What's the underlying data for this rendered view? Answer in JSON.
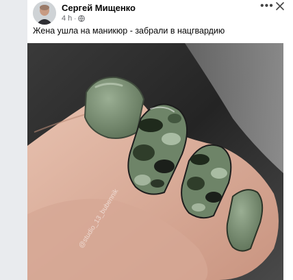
{
  "post": {
    "author": "Сергей Мищенко",
    "time": "4 h",
    "separator": "·",
    "audience_icon": "globe-icon",
    "more_icon": "more-options-icon",
    "more_glyph": "•••",
    "close_icon": "close-icon",
    "text": "Жена ушла на маникюр - забрали в нацгвардию"
  },
  "photo": {
    "subject": "hand with khaki and camouflage nail polish",
    "watermark": "@studio_13_bubennik"
  },
  "colors": {
    "card_bg": "#ffffff",
    "page_bg": "#e9ebee",
    "author_text": "#050505",
    "meta_text": "#65676b",
    "nail_green": "#7d9177"
  }
}
